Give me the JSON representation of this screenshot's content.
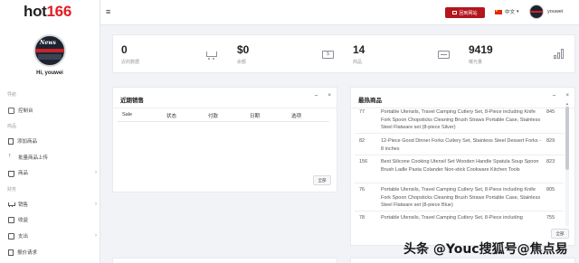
{
  "brand": {
    "prefix": "hot",
    "number": "166"
  },
  "sidebar": {
    "greeting": "Hi, youwei",
    "sections": [
      "导航",
      "商品",
      "财务"
    ],
    "items": [
      {
        "label": "控制台",
        "icon": "dashboard-icon"
      },
      {
        "label": "添加商品",
        "icon": "document-icon"
      },
      {
        "label": "批量商品上传",
        "icon": "upload-icon"
      },
      {
        "label": "商品",
        "icon": "shopping-bag-icon"
      },
      {
        "label": "销售",
        "icon": "cart-icon"
      },
      {
        "label": "收益",
        "icon": "money-icon"
      },
      {
        "label": "支出",
        "icon": "money-out-icon"
      },
      {
        "label": "报价请求",
        "icon": "quote-icon"
      }
    ]
  },
  "header": {
    "back_label": "回到网站",
    "language": "中文",
    "username": "youwei"
  },
  "stats": [
    {
      "value": "0",
      "label": "近的数据",
      "icon": "cart-icon"
    },
    {
      "value": "$0",
      "label": "余额",
      "icon": "money-icon"
    },
    {
      "value": "14",
      "label": "商品",
      "icon": "document-icon"
    },
    {
      "value": "9419",
      "label": "曝光量",
      "icon": "basket-icon"
    }
  ],
  "recent_sales": {
    "title": "近期销售",
    "columns": [
      "Sale",
      "状态",
      "付款",
      "日期",
      "选项"
    ],
    "all_label": "全部"
  },
  "top_products": {
    "title": "最热商品",
    "all_label": "全部",
    "rows": [
      {
        "id": "77",
        "name": "Portable Utensils, Travel Camping Cutlery Set, 8-Piece including Knife Fork Spoon Chopsticks Cleaning Brush Straws Portable Case, Stainless Steel Flatware set (8-piece Silver)",
        "count": "845"
      },
      {
        "id": "82",
        "name": "12-Piece Good Dinner Forks Cutlery Set, Stainless Steel Dessert Forks - 8 inches",
        "count": "829"
      },
      {
        "id": "156",
        "name": "Best Silicone Cooking Utensil Set Wooden Handle Spatula Soup Spoon Brush Ladle Pasta Colander Non-stick Cookware Kitchen Tools",
        "count": "823"
      },
      {
        "id": "76",
        "name": "Portable Utensils, Travel Camping Cutlery Set, 8-Piece including Knife Fork Spoon Chopsticks Cleaning Brush Straws Portable Case, Stainless Steel Flatware set (8-piece Blue)",
        "count": "805"
      },
      {
        "id": "78",
        "name": "Portable Utensils, Travel Camping Cutlery Set, 8-Piece including",
        "count": "755"
      }
    ]
  },
  "watermark": "头条 @Youc搜狐号@焦点易"
}
